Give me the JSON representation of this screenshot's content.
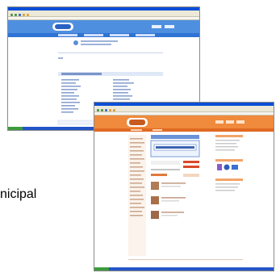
{
  "caption": {
    "text": "nicipal"
  },
  "back_window": {
    "site_name": "",
    "nav_items": [
      "",
      "",
      "",
      ""
    ]
  },
  "front_window": {
    "site_name": "",
    "nav_items": [
      "",
      "",
      ""
    ]
  },
  "colors": {
    "back_accent": "#4f8fe0",
    "front_accent": "#f08a3c",
    "xp_titlebar": "#0a4fd6",
    "xp_taskbar": "#2455c8"
  }
}
